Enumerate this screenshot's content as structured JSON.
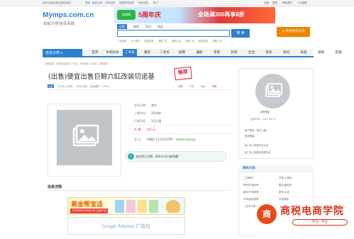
{
  "topbar": {
    "left": "你好,欢迎光临分类信息网",
    "login": "登录",
    "register": "免费注册",
    "items": [
      "手机浏览",
      "快速发布信息",
      "商业信息",
      "热门"
    ],
    "right": [
      "注册",
      "登录",
      "联系我们",
      "QQ客服"
    ]
  },
  "logo": {
    "title": "Mymps.com.cn",
    "subtitle": "蚂蚁分类信息系统"
  },
  "banner": {
    "badge": "蚂蚁网",
    "text1": "5周年庆",
    "text2": "全场满300再享8折"
  },
  "search": {
    "tabs": [
      "信息",
      "商家",
      "资讯",
      "商品"
    ],
    "placeholder": "",
    "button": "搜 索",
    "hot": [
      "广告招商",
      "开心酷车",
      "房屋出租",
      "求职工作",
      "家居生活",
      "商家广告",
      "租房信息",
      "求职工作"
    ]
  },
  "post_button": "免费发布信息",
  "nav": {
    "category": "信息分类",
    "items": [
      "首页",
      "手机码付",
      "二手车",
      "租房",
      "二手房",
      "招聘",
      "兼职",
      "求职",
      "狗狗",
      "生活",
      "商务",
      "资讯",
      "商品",
      "团购",
      "店铺"
    ],
    "active_index": 2
  },
  "breadcrumb": "当前位置：分类信息首页 > 北京二手车买卖 > 北京二手乘用车",
  "title": "(出售)便宜出售巨鲸六缸改装切诺基",
  "stamp": "推荐",
  "meta": {
    "badge": "认证",
    "date": "16-06-15发布",
    "views": "424次浏览",
    "id": "信息编号：15230",
    "fav": "收藏",
    "share": "分享",
    "edit": "修改",
    "report": "举报"
  },
  "details": [
    {
      "k": "轿车品牌：",
      "v": "其它"
    },
    {
      "k": "上牌年份：",
      "v": "2016年"
    },
    {
      "k": "行驶里程：",
      "v": "1万公里"
    },
    {
      "k": "价    格：",
      "v": "25万元"
    },
    {
      "k": "地    址：",
      "v": "中原区  111132195*"
    }
  ],
  "verified_link": "联系我们电话/地址",
  "tip": "该信息已过期，联系方式已被隐藏！",
  "section_title": "信息详情",
  "ad1": {
    "title": "黄金帮宝适",
    "strip": "370/M56/L46/XL36 立省99元"
  },
  "ad2": "Google Adsense 广告位",
  "user": {
    "name": "yesky",
    "reg": "注册时间：2011-06-10",
    "lines": [
      "用户身份：新手上路",
      "信用等级：",
      "未上传身份证认证",
      "未上传营业执照认证"
    ]
  },
  "related": {
    "title": "相关分类",
    "items": [
      "二手轿车",
      "货车/工程车",
      "摩托车/电动车",
      "客车/面包车",
      "新车/汽车配件",
      "新车4S店",
      "汽车用品/配件",
      "汽车服务",
      "二手车汽车交易",
      "驾校/陪驾"
    ]
  },
  "watermark": {
    "logo": "商",
    "title": "商税电商学院",
    "slogan": "专注 · 专业"
  }
}
